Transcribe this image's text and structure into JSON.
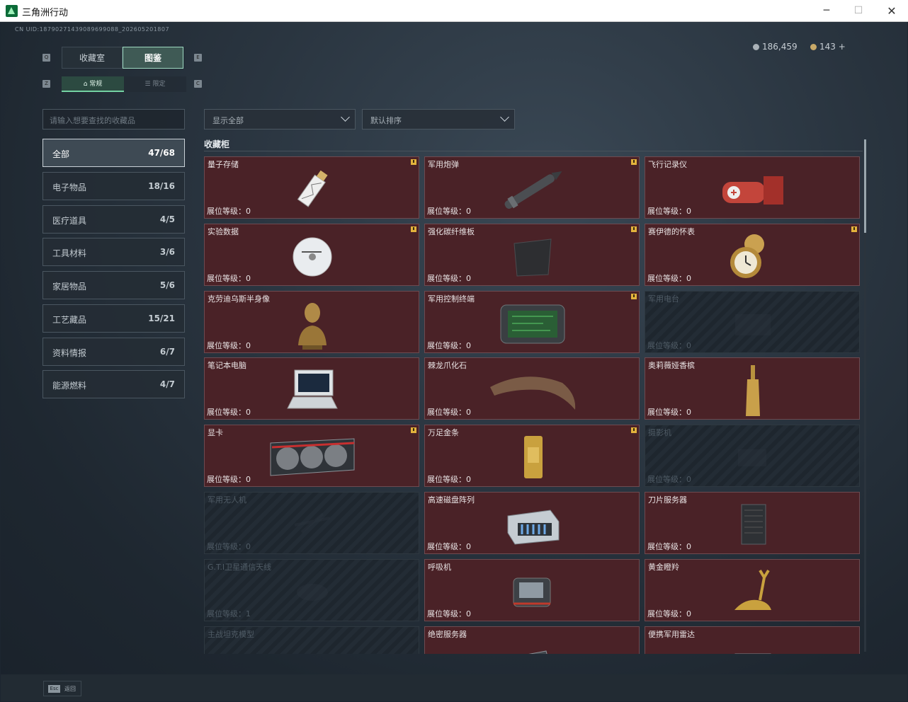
{
  "window": {
    "title": "三角洲行动",
    "min": "─",
    "max": "☐",
    "close": "✕"
  },
  "uid": "CN UID:18790271439089699088_202605201807",
  "currency": {
    "silver": "186,459",
    "gold": "143 +"
  },
  "colors": {
    "accent": "#74d2a3",
    "card_bg": "#4a2227",
    "badge": "#e3b33c"
  },
  "top_tabs": [
    {
      "label": "收藏室"
    },
    {
      "label": "图鉴"
    }
  ],
  "sub_tabs": [
    {
      "label": "常规"
    },
    {
      "label": "限定"
    }
  ],
  "key_hints": {
    "q": "Q",
    "e": "E",
    "z": "Z",
    "c": "C"
  },
  "search": {
    "placeholder": "请输入想要查找的收藏品"
  },
  "filters": {
    "show": "显示全部",
    "sort": "默认排序"
  },
  "categories": [
    {
      "label": "全部",
      "count": "47/68"
    },
    {
      "label": "电子物品",
      "count": "18/16"
    },
    {
      "label": "医疗道具",
      "count": "4/5"
    },
    {
      "label": "工具材料",
      "count": "3/6"
    },
    {
      "label": "家居物品",
      "count": "5/6"
    },
    {
      "label": "工艺藏品",
      "count": "15/21"
    },
    {
      "label": "资料情报",
      "count": "6/7"
    },
    {
      "label": "能源燃料",
      "count": "4/7"
    }
  ],
  "cabinet_title": "收藏柜",
  "items": [
    {
      "name": "量子存储",
      "level": "展位等级：0",
      "icon": "usb-icon",
      "new": true
    },
    {
      "name": "军用炮弹",
      "level": "展位等级：0",
      "icon": "shell-icon",
      "new": true
    },
    {
      "name": "飞行记录仪",
      "level": "展位等级：0",
      "icon": "flight-recorder-icon",
      "new": false
    },
    {
      "name": "实验数据",
      "level": "展位等级：0",
      "icon": "disc-icon",
      "new": true
    },
    {
      "name": "强化碳纤维板",
      "level": "展位等级：0",
      "icon": "carbon-plate-icon",
      "new": true
    },
    {
      "name": "赛伊德的怀表",
      "level": "展位等级：0",
      "icon": "pocket-watch-icon",
      "new": true
    },
    {
      "name": "克劳迪乌斯半身像",
      "level": "展位等级：0",
      "icon": "bust-icon",
      "new": false
    },
    {
      "name": "军用控制终端",
      "level": "展位等级：0",
      "icon": "terminal-icon",
      "new": true
    },
    {
      "name": "军用电台",
      "level": "展位等级：0",
      "icon": "radio-icon",
      "locked": true
    },
    {
      "name": "笔记本电脑",
      "level": "展位等级：0",
      "icon": "laptop-icon",
      "new": false
    },
    {
      "name": "棘龙爪化石",
      "level": "展位等级：0",
      "icon": "claw-icon",
      "new": false
    },
    {
      "name": "奥莉薇娅香槟",
      "level": "展位等级：0",
      "icon": "champagne-icon",
      "new": false
    },
    {
      "name": "显卡",
      "level": "展位等级：0",
      "icon": "gpu-icon",
      "new": true
    },
    {
      "name": "万足金条",
      "level": "展位等级：0",
      "icon": "gold-bar-icon",
      "new": true
    },
    {
      "name": "摄影机",
      "level": "展位等级：0",
      "icon": "camera-icon",
      "locked": true
    },
    {
      "name": "军用无人机",
      "level": "展位等级：0",
      "icon": "drone-icon",
      "locked": true
    },
    {
      "name": "高速磁盘阵列",
      "level": "展位等级：0",
      "icon": "disk-array-icon",
      "new": false
    },
    {
      "name": "刀片服务器",
      "level": "展位等级：0",
      "icon": "blade-server-icon",
      "new": false
    },
    {
      "name": "G.T.I卫星通信天线",
      "level": "展位等级：1",
      "icon": "satellite-dish-icon",
      "locked": true
    },
    {
      "name": "呼吸机",
      "level": "展位等级：0",
      "icon": "ventilator-icon",
      "new": false
    },
    {
      "name": "黄金瞪羚",
      "level": "展位等级：0",
      "icon": "gold-gazelle-icon",
      "new": false
    },
    {
      "name": "主战坦克模型",
      "level": "",
      "icon": "tank-model-icon",
      "locked": true
    },
    {
      "name": "绝密服务器",
      "level": "",
      "icon": "secret-server-icon",
      "new": false
    },
    {
      "name": "便携军用雷达",
      "level": "",
      "icon": "radar-icon",
      "new": false
    }
  ],
  "footer": {
    "esc_key": "Esc",
    "esc_label": "返回"
  }
}
